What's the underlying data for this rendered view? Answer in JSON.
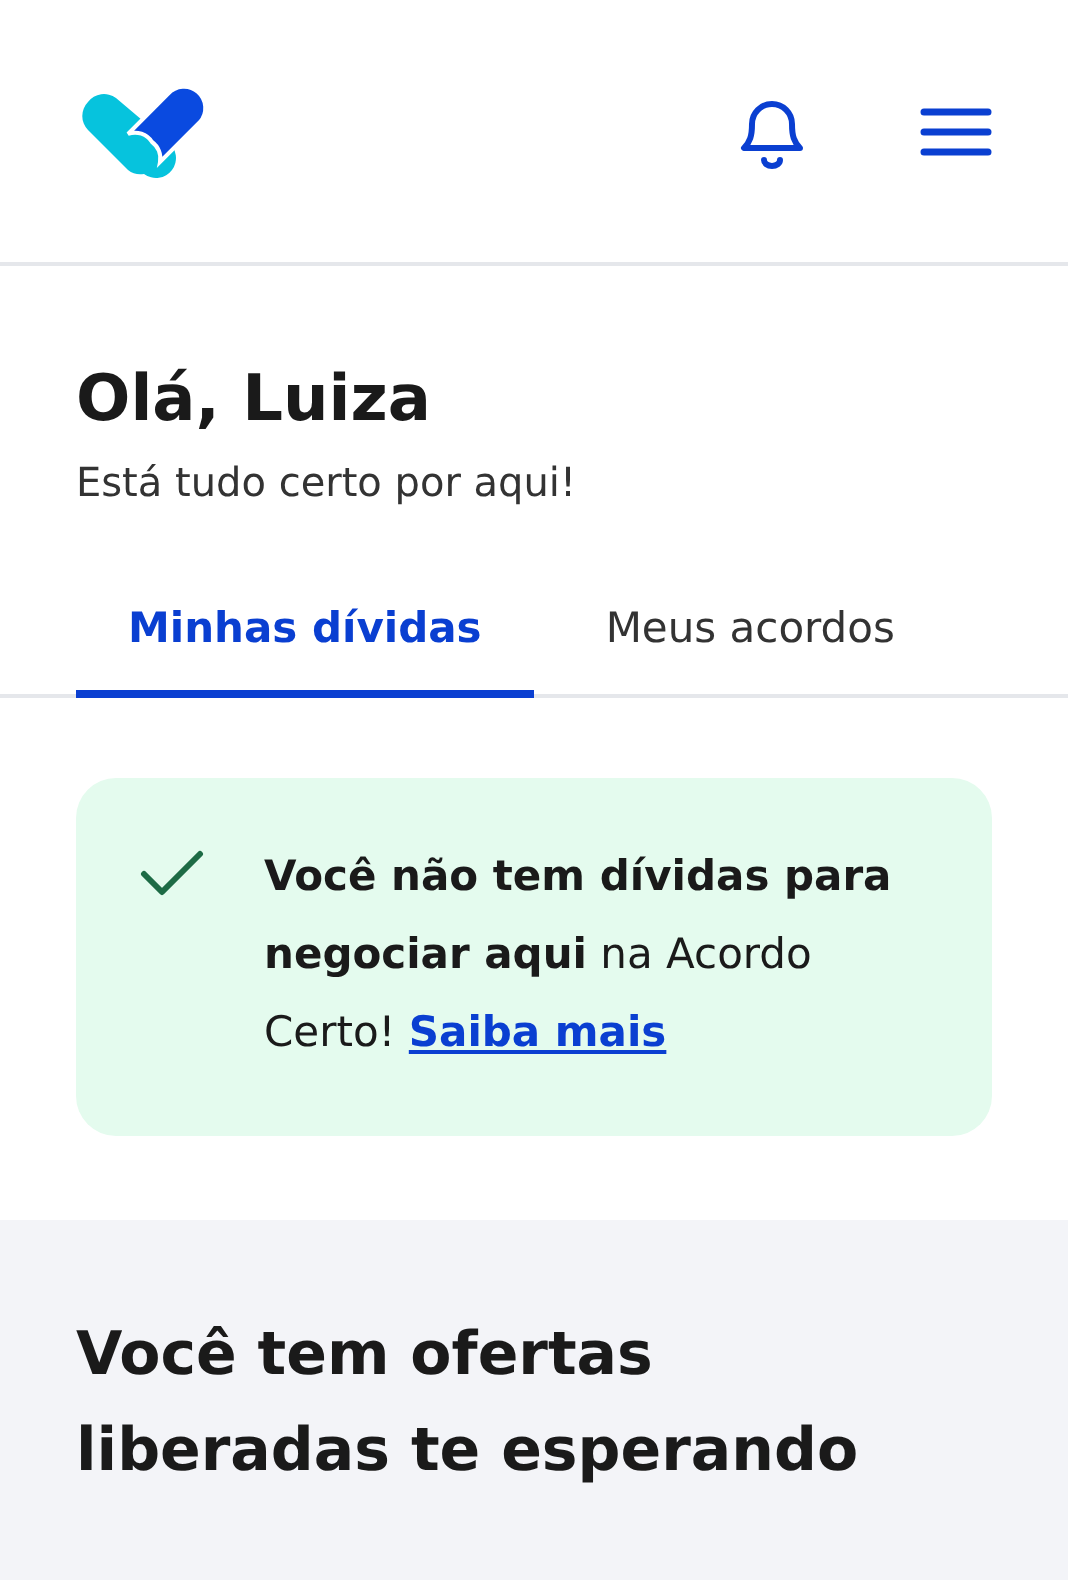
{
  "greeting": {
    "title": "Olá, Luiza",
    "subtitle": "Está tudo certo por aqui!"
  },
  "tabs": [
    {
      "label": "Minhas dívidas",
      "selected": true
    },
    {
      "label": "Meus acordos",
      "selected": false
    }
  ],
  "alert": {
    "message": "**Você não tem dívidas para negociar aqui** na Acordo Certo!",
    "link": "Saiba mais"
  },
  "offers": {
    "title": "Você tem ofertas liberadas te esperando"
  }
}
